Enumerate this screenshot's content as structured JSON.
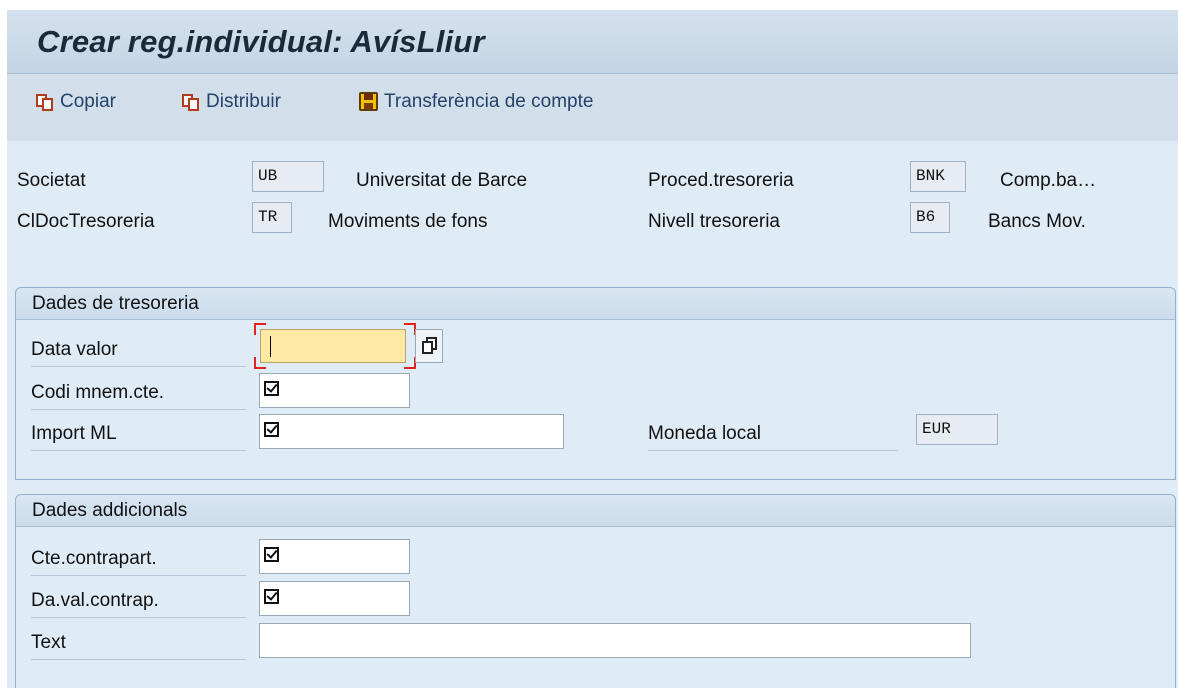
{
  "window": {
    "title": "Crear reg.individual: AvísLliur"
  },
  "toolbar": {
    "copy_label": "Copiar",
    "distribute_label": "Distribuir",
    "transfer_label": "Transferència de compte"
  },
  "header": {
    "company_label": "Societat",
    "company_value": "UB",
    "company_text": "Universitat de Barce",
    "doc_class_label": "ClDocTresoreria",
    "doc_class_value": "TR",
    "doc_class_text": "Moviments de fons",
    "procedure_label": "Proced.tresoreria",
    "procedure_value": "BNK",
    "procedure_text": "Comp.ba…",
    "level_label": "Nivell tresoreria",
    "level_value": "B6",
    "level_text": "Bancs Mov."
  },
  "treasury": {
    "title": "Dades de tresoreria",
    "value_date_label": "Data valor",
    "value_date_value": "",
    "mnemonic_label": "Codi mnem.cte.",
    "amount_label": "Import ML",
    "currency_label": "Moneda local",
    "currency_value": "EUR"
  },
  "additional": {
    "title": "Dades addicionals",
    "counter_account_label": "Cte.contrapart.",
    "counter_date_label": "Da.val.contrap.",
    "text_label": "Text",
    "text_value": ""
  },
  "icons": [
    "copy-icon",
    "distribute-icon",
    "save-icon",
    "checkbox-icon",
    "value-help-icon"
  ],
  "colors": {
    "required_bg": "#fde9a4",
    "focus_corners": "#e0241b",
    "accent": "#23436a"
  }
}
